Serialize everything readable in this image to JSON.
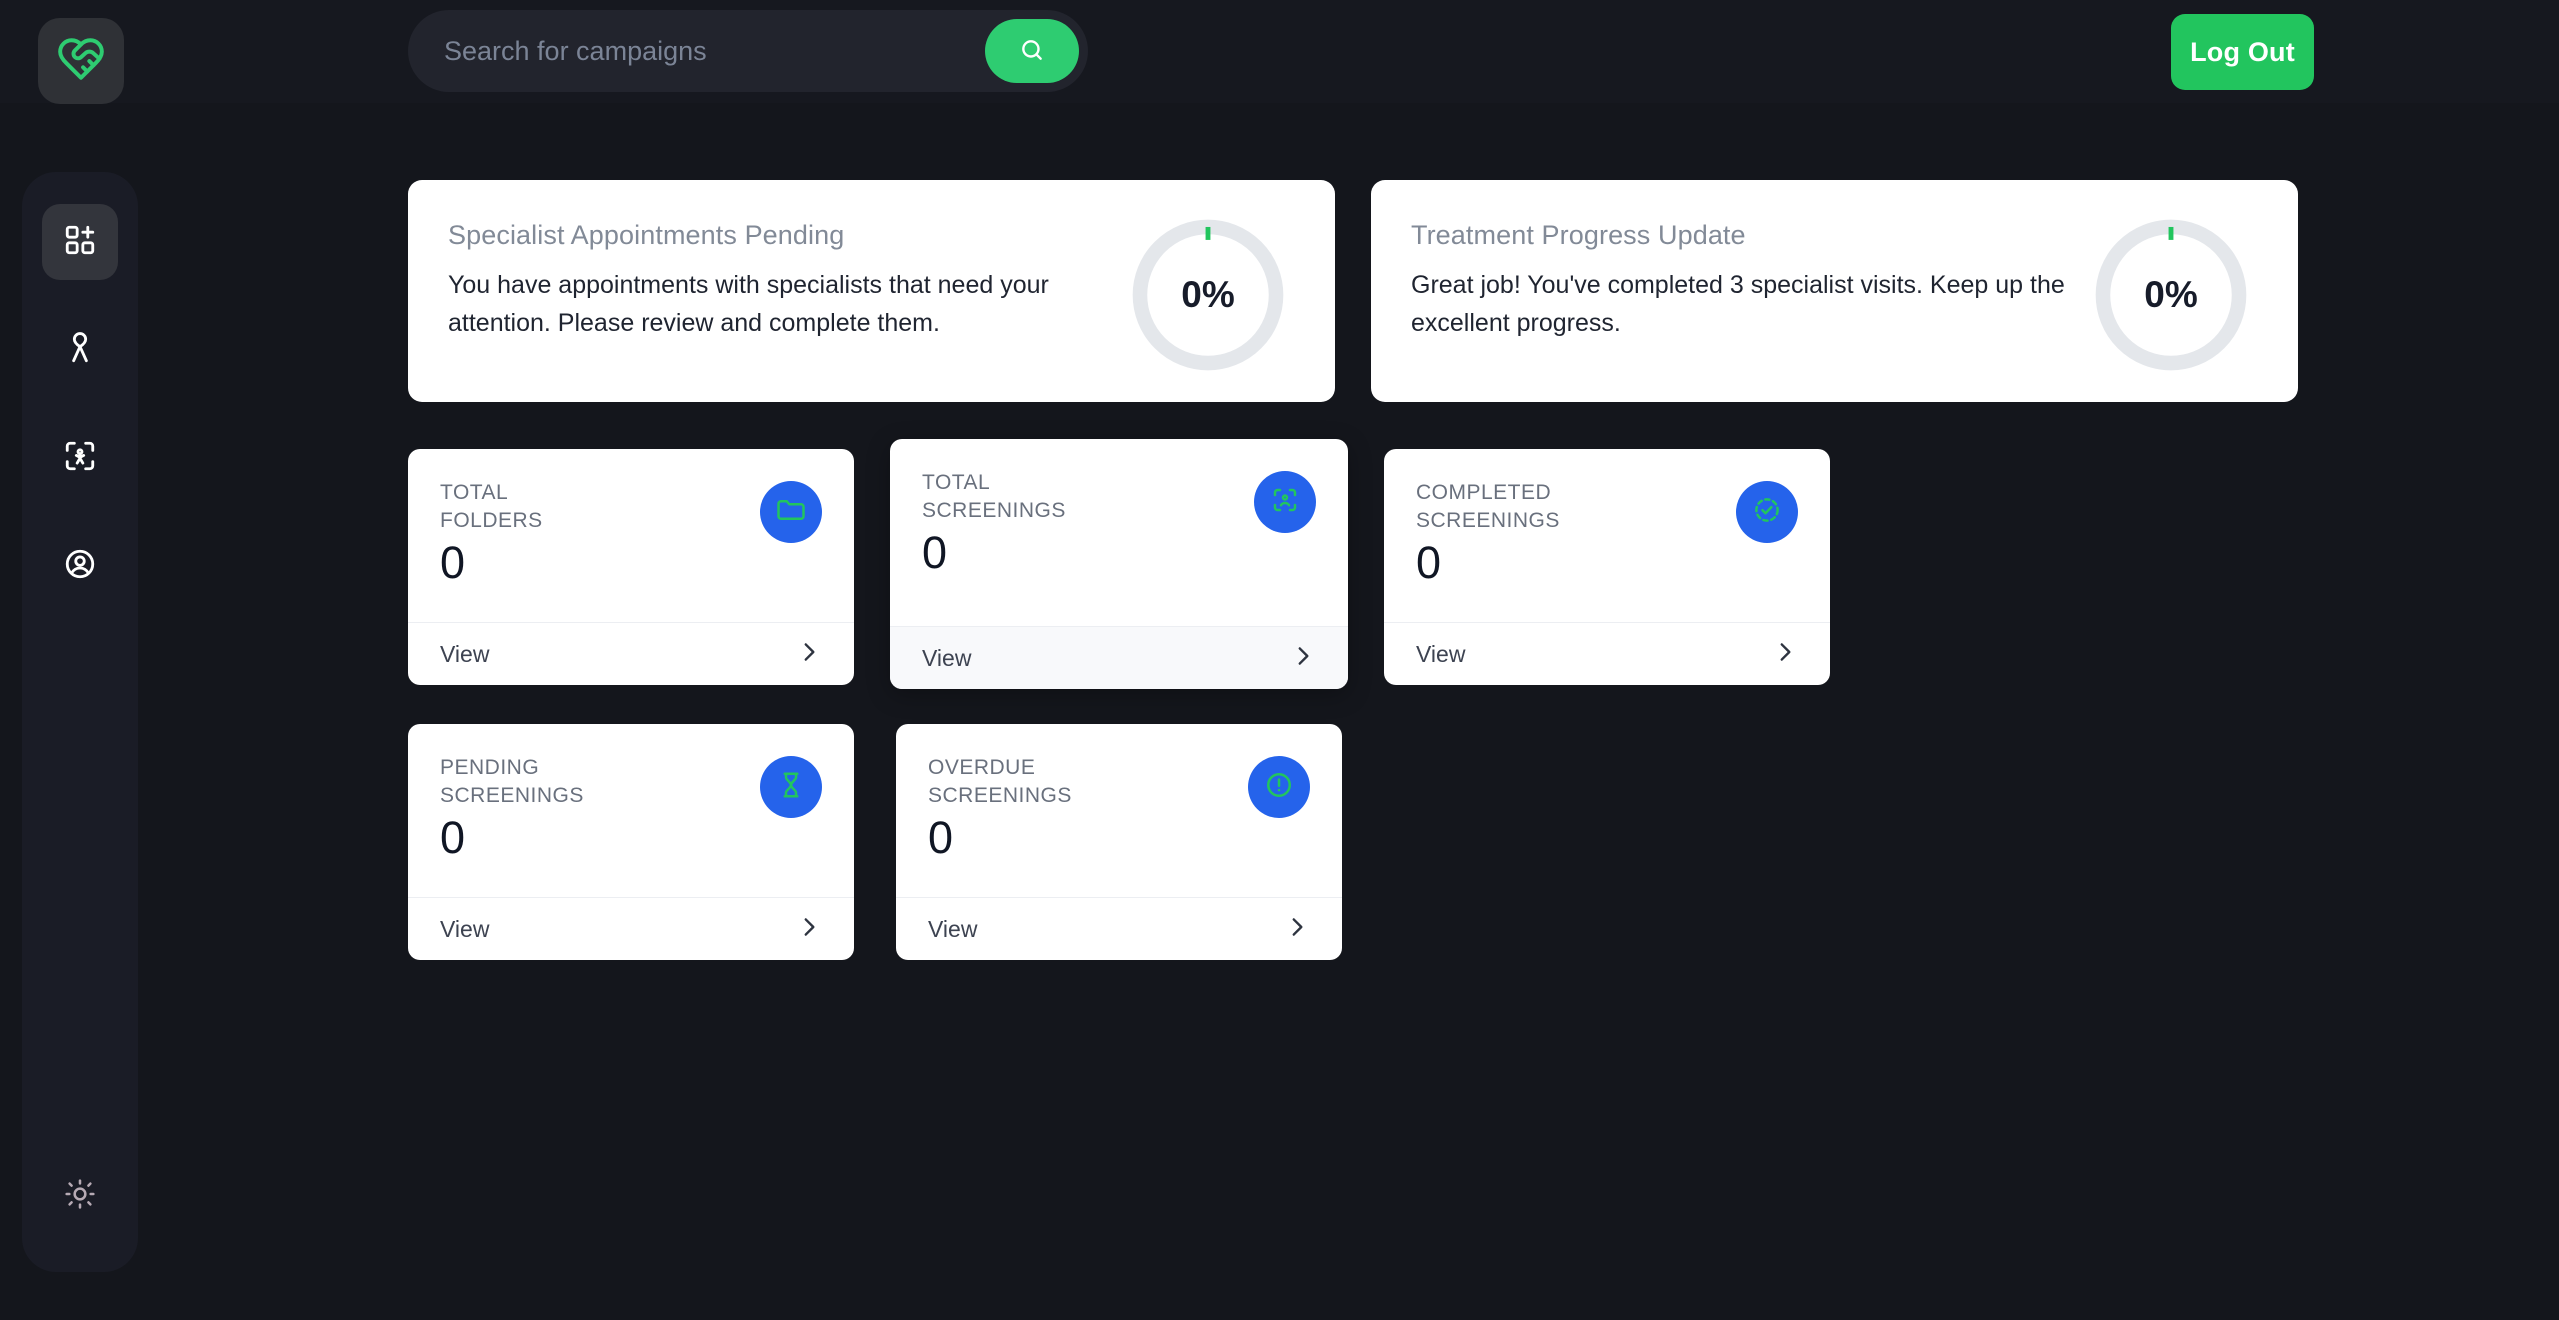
{
  "theme": {
    "page_bg": "#14161c",
    "panel_bg": "#1a1c26",
    "accent_green": "#22c55e",
    "badge_blue": "#2563eb",
    "icon_green": "#22c55e",
    "card_white": "#ffffff"
  },
  "topbar": {
    "logo_icon": "heart-handshake-logo",
    "search": {
      "placeholder": "Search for campaigns",
      "value": "",
      "button_icon": "search-icon"
    },
    "logout_label": "Log Out"
  },
  "sidebar": {
    "items": [
      {
        "icon": "grid-plus-icon",
        "name": "dashboard",
        "active": true
      },
      {
        "icon": "ribbon-icon",
        "name": "campaigns",
        "active": false
      },
      {
        "icon": "person-scan-icon",
        "name": "screenings",
        "active": false
      },
      {
        "icon": "user-circle-icon",
        "name": "profile",
        "active": false
      }
    ],
    "theme_toggle_icon": "sun-icon"
  },
  "alerts": [
    {
      "title": "Specialist Appointments Pending",
      "body": "You have appointments with specialists that need your attention. Please review and complete them.",
      "progress_label": "0%",
      "progress_value": 0
    },
    {
      "title": "Treatment Progress Update",
      "body": "Great job! You've completed 3 specialist visits. Keep up the excellent progress.",
      "progress_label": "0%",
      "progress_value": 0
    }
  ],
  "stats": [
    {
      "label": "TOTAL\nFOLDERS",
      "value": "0",
      "icon": "folder-icon",
      "action_label": "View",
      "chevron": "chevron-right-icon",
      "raised": false,
      "footer_tinted": false
    },
    {
      "label": "TOTAL\nSCREENINGS",
      "value": "0",
      "icon": "face-scan-icon",
      "action_label": "View",
      "chevron": "chevron-right-icon",
      "raised": true,
      "footer_tinted": true
    },
    {
      "label": "COMPLETED\nSCREENINGS",
      "value": "0",
      "icon": "check-dashed-icon",
      "action_label": "View",
      "chevron": "chevron-right-icon",
      "raised": false,
      "footer_tinted": false
    },
    {
      "label": "PENDING\nSCREENINGS",
      "value": "0",
      "icon": "hourglass-icon",
      "action_label": "View",
      "chevron": "chevron-right-icon",
      "raised": false,
      "footer_tinted": false
    },
    {
      "label": "OVERDUE\nSCREENINGS",
      "value": "0",
      "icon": "alert-circle-icon",
      "action_label": "View",
      "chevron": "chevron-right-icon",
      "raised": false,
      "footer_tinted": false
    }
  ]
}
